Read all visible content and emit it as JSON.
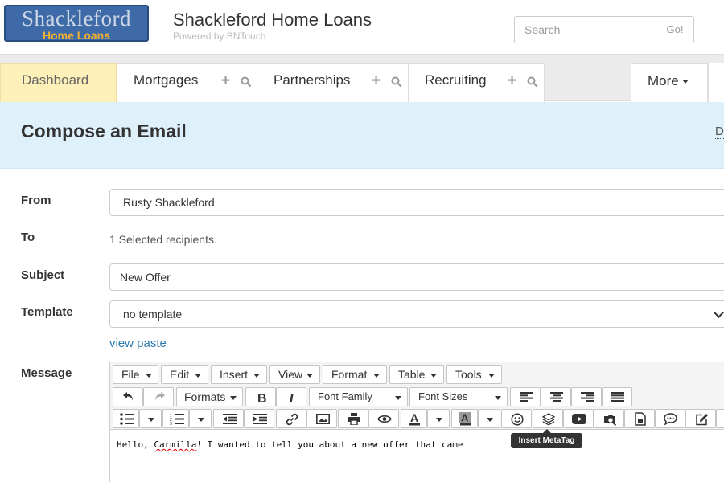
{
  "header": {
    "logo_line1": "Shackleford",
    "logo_line2": "Home Loans",
    "title": "Shackleford Home Loans",
    "subtitle": "Powered by BNTouch",
    "search_placeholder": "Search",
    "search_button": "Go!"
  },
  "nav": {
    "tabs": [
      {
        "label": "Dashboard",
        "active": true
      },
      {
        "label": "Mortgages"
      },
      {
        "label": "Partnerships"
      },
      {
        "label": "Recruiting"
      }
    ],
    "more_label": "More"
  },
  "banner": {
    "title": "Compose an Email",
    "edge_text": "D"
  },
  "form": {
    "from_label": "From",
    "from_value": "Rusty Shackleford",
    "to_label": "To",
    "to_value": "1 Selected recipients.",
    "subject_label": "Subject",
    "subject_value": "New Offer",
    "template_label": "Template",
    "template_value": "no template",
    "view_paste": "view paste",
    "message_label": "Message"
  },
  "editor": {
    "menus": [
      "File",
      "Edit",
      "Insert",
      "View",
      "Format",
      "Table",
      "Tools"
    ],
    "formats_label": "Formats",
    "font_family_label": "Font Family",
    "font_sizes_label": "Font Sizes",
    "text_before": "Hello, ",
    "text_name": "Carmilla",
    "text_after": "! I wanted to tell you about a new offer that came",
    "tooltip": "Insert MetaTag"
  },
  "colors": {
    "active_tab_bg": "#fdf0b8",
    "banner_bg": "#def0fa",
    "link": "#2a7ab0",
    "logo_bg": "#3f6aa8",
    "logo_accent": "#f0b030"
  }
}
